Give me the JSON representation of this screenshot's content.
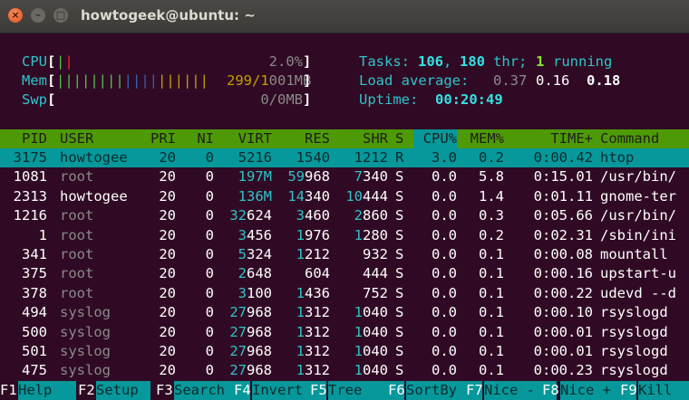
{
  "window": {
    "title": "howtogeek@ubuntu: ~"
  },
  "meters": {
    "cpu": {
      "label": "CPU",
      "value": "2.0%"
    },
    "mem": {
      "label": "Mem",
      "value_a": "299/1",
      "value_b": "001MB"
    },
    "swp": {
      "label": "Swp",
      "value": "0/0MB"
    }
  },
  "summary": {
    "tasks_label": "Tasks:",
    "tasks": "106",
    "comma": ",",
    "threads": "180",
    "thr_label": "thr;",
    "running": "1",
    "running_label": "running",
    "load_label": "Load average:",
    "load1": "0.37",
    "load5": "0.16",
    "load15": "0.18",
    "uptime_label": "Uptime:",
    "uptime": "00:20:49"
  },
  "columns": [
    "PID",
    "USER",
    "PRI",
    "NI",
    "VIRT",
    "RES",
    "SHR",
    "S",
    "CPU%",
    "MEM%",
    "TIME+",
    "Command"
  ],
  "processes": [
    {
      "pid": "3175",
      "user": "howtogee",
      "pri": "20",
      "ni": "0",
      "virt": "5216",
      "res": "1540",
      "shr": "1212",
      "s": "R",
      "cpu": "3.0",
      "mem": "0.2",
      "time": "0:00.42",
      "cmd": "htop"
    },
    {
      "pid": "1081",
      "user": "root",
      "pri": "20",
      "ni": "0",
      "virt": "197M",
      "res": "59968",
      "shr": "7340",
      "s": "S",
      "cpu": "0.0",
      "mem": "5.8",
      "time": "0:15.01",
      "cmd": "/usr/bin/"
    },
    {
      "pid": "2313",
      "user": "howtogee",
      "pri": "20",
      "ni": "0",
      "virt": "136M",
      "res": "14340",
      "shr": "10444",
      "s": "S",
      "cpu": "0.0",
      "mem": "1.4",
      "time": "0:01.11",
      "cmd": "gnome-ter"
    },
    {
      "pid": "1216",
      "user": "root",
      "pri": "20",
      "ni": "0",
      "virt": "32624",
      "res": "3460",
      "shr": "2860",
      "s": "S",
      "cpu": "0.0",
      "mem": "0.3",
      "time": "0:05.66",
      "cmd": "/usr/bin/"
    },
    {
      "pid": "1",
      "user": "root",
      "pri": "20",
      "ni": "0",
      "virt": "3456",
      "res": "1976",
      "shr": "1280",
      "s": "S",
      "cpu": "0.0",
      "mem": "0.2",
      "time": "0:02.31",
      "cmd": "/sbin/ini"
    },
    {
      "pid": "341",
      "user": "root",
      "pri": "20",
      "ni": "0",
      "virt": "5324",
      "res": "1212",
      "shr": "932",
      "s": "S",
      "cpu": "0.0",
      "mem": "0.1",
      "time": "0:00.08",
      "cmd": "mountall"
    },
    {
      "pid": "375",
      "user": "root",
      "pri": "20",
      "ni": "0",
      "virt": "2648",
      "res": "604",
      "shr": "444",
      "s": "S",
      "cpu": "0.0",
      "mem": "0.1",
      "time": "0:00.16",
      "cmd": "upstart-u"
    },
    {
      "pid": "378",
      "user": "root",
      "pri": "20",
      "ni": "0",
      "virt": "3100",
      "res": "1436",
      "shr": "752",
      "s": "S",
      "cpu": "0.0",
      "mem": "0.1",
      "time": "0:00.22",
      "cmd": "udevd --d"
    },
    {
      "pid": "494",
      "user": "syslog",
      "pri": "20",
      "ni": "0",
      "virt": "27968",
      "res": "1312",
      "shr": "1040",
      "s": "S",
      "cpu": "0.0",
      "mem": "0.1",
      "time": "0:00.10",
      "cmd": "rsyslogd"
    },
    {
      "pid": "500",
      "user": "syslog",
      "pri": "20",
      "ni": "0",
      "virt": "27968",
      "res": "1312",
      "shr": "1040",
      "s": "S",
      "cpu": "0.0",
      "mem": "0.1",
      "time": "0:00.01",
      "cmd": "rsyslogd"
    },
    {
      "pid": "501",
      "user": "syslog",
      "pri": "20",
      "ni": "0",
      "virt": "27968",
      "res": "1312",
      "shr": "1040",
      "s": "S",
      "cpu": "0.0",
      "mem": "0.1",
      "time": "0:00.01",
      "cmd": "rsyslogd"
    },
    {
      "pid": "475",
      "user": "syslog",
      "pri": "20",
      "ni": "0",
      "virt": "27968",
      "res": "1312",
      "shr": "1040",
      "s": "S",
      "cpu": "0.0",
      "mem": "0.1",
      "time": "0:00.23",
      "cmd": "rsyslogd"
    }
  ],
  "fkeys": [
    {
      "key": "F1",
      "label": "Help"
    },
    {
      "key": "F2",
      "label": "Setup"
    },
    {
      "key": "F3",
      "label": "Search"
    },
    {
      "key": "F4",
      "label": "Invert"
    },
    {
      "key": "F5",
      "label": "Tree"
    },
    {
      "key": "F6",
      "label": "SortBy"
    },
    {
      "key": "F7",
      "label": "Nice -"
    },
    {
      "key": "F8",
      "label": "Nice +"
    },
    {
      "key": "F9",
      "label": "Kill"
    }
  ],
  "colors": {
    "terminal_bg": "#300a24",
    "header_green": "#4e9a06",
    "selection_cyan": "#06989a"
  }
}
